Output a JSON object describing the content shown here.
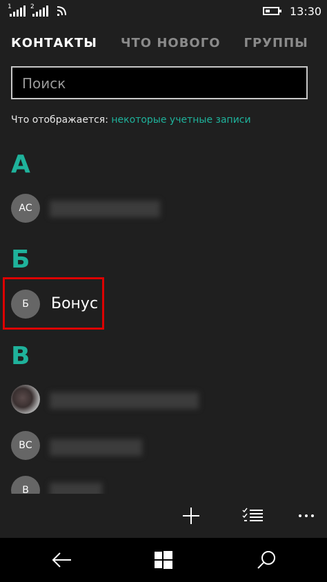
{
  "status": {
    "time": "13:30",
    "sim1_label": "1",
    "sim2_label": "2"
  },
  "tabs": [
    {
      "label": "КОНТАКТЫ"
    },
    {
      "label": "ЧТО НОВОГО"
    },
    {
      "label": "ГРУППЫ"
    }
  ],
  "search": {
    "placeholder": "Поиск"
  },
  "showing": {
    "label": "Что отображается:",
    "link": "некоторые учетные записи"
  },
  "groups": [
    {
      "letter": "А",
      "contacts": [
        {
          "initials": "АС",
          "name": ""
        }
      ]
    },
    {
      "letter": "Б",
      "contacts": [
        {
          "initials": "Б",
          "name": "Бонус"
        }
      ]
    },
    {
      "letter": "В",
      "contacts": [
        {
          "initials": "",
          "name": ""
        },
        {
          "initials": "ВС",
          "name": ""
        },
        {
          "initials": "В",
          "name": ""
        }
      ]
    }
  ],
  "colors": {
    "accent": "#1fb29b",
    "highlight": "#dd0000",
    "background": "#1f1f1f"
  },
  "appbar": {
    "icons": [
      "add-icon",
      "select-list-icon",
      "more-icon"
    ]
  },
  "navbar": {
    "icons": [
      "back-icon",
      "windows-start-icon",
      "search-icon"
    ]
  }
}
